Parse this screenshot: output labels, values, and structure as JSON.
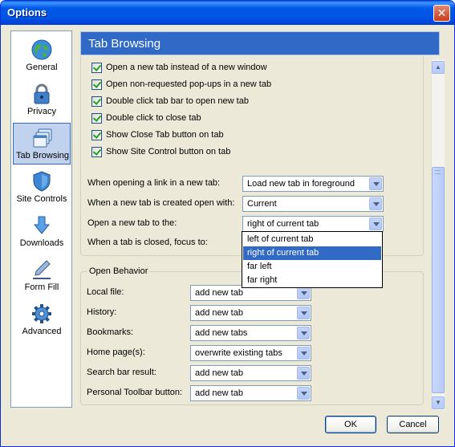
{
  "window": {
    "title": "Options"
  },
  "sidebar": {
    "items": [
      {
        "label": "General",
        "icon": "globe-icon"
      },
      {
        "label": "Privacy",
        "icon": "padlock-icon"
      },
      {
        "label": "Tab Browsing",
        "icon": "tabs-icon",
        "selected": true
      },
      {
        "label": "Site Controls",
        "icon": "shield-icon"
      },
      {
        "label": "Downloads",
        "icon": "download-arrow-icon"
      },
      {
        "label": "Form Fill",
        "icon": "pen-icon"
      },
      {
        "label": "Advanced",
        "icon": "gear-icon"
      }
    ]
  },
  "panel": {
    "title": "Tab Browsing"
  },
  "checkboxes": [
    {
      "label": "Open a new tab instead of a new window",
      "checked": true
    },
    {
      "label": "Open non-requested pop-ups in a new tab",
      "checked": true
    },
    {
      "label": "Double click tab bar to open new tab",
      "checked": true
    },
    {
      "label": "Double click to close tab",
      "checked": true
    },
    {
      "label": "Show Close Tab button on tab",
      "checked": true
    },
    {
      "label": "Show Site Control button on tab",
      "checked": true
    }
  ],
  "settings": [
    {
      "label": "When opening a link in a new tab:",
      "value": "Load new tab in foreground"
    },
    {
      "label": "When a new tab is created open with:",
      "value": "Current"
    },
    {
      "label": "Open a new tab to the:",
      "value": "right of current tab"
    },
    {
      "label": "When a tab is closed, focus to:"
    }
  ],
  "dropdown_open": {
    "options": [
      "left of current tab",
      "right of current tab",
      "far left",
      "far right"
    ],
    "selected": "right of current tab"
  },
  "open_behavior": {
    "title": "Open Behavior",
    "rows": [
      {
        "label": "Local file:",
        "value": "add new tab"
      },
      {
        "label": "History:",
        "value": "add new tab"
      },
      {
        "label": "Bookmarks:",
        "value": "add new tabs"
      },
      {
        "label": "Home page(s):",
        "value": "overwrite existing tabs"
      },
      {
        "label": "Search bar result:",
        "value": "add new tab"
      },
      {
        "label": "Personal Toolbar button:",
        "value": "add new tab"
      }
    ]
  },
  "buttons": {
    "ok": "OK",
    "cancel": "Cancel"
  },
  "colors": {
    "title_bar": "#0054e3",
    "header": "#3169c6",
    "selection": "#316ac5"
  }
}
